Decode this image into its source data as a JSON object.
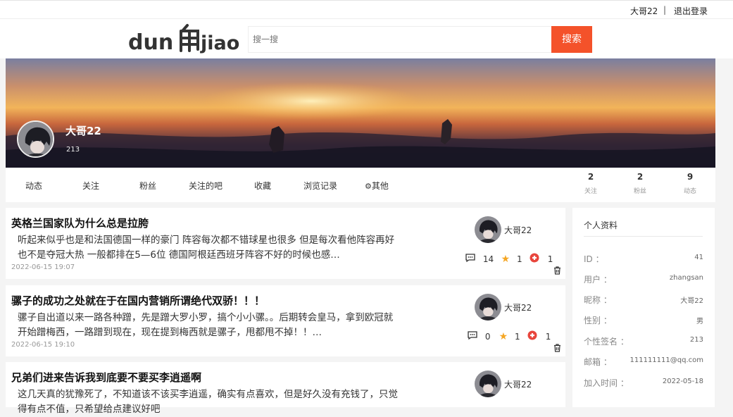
{
  "topbar": {
    "username": "大哥22",
    "separator": "|",
    "logout": "退出登录"
  },
  "header": {
    "logo_text": "dunjiao",
    "search_placeholder": "搜一搜",
    "search_button": "搜索"
  },
  "profile": {
    "name": "大哥22",
    "signature": "213"
  },
  "nav": {
    "tabs": [
      "动态",
      "关注",
      "粉丝",
      "关注的吧",
      "收藏",
      "浏览记录",
      "其他"
    ],
    "stats": [
      {
        "value": "2",
        "label": "关注"
      },
      {
        "value": "2",
        "label": "粉丝"
      },
      {
        "value": "9",
        "label": "动态"
      }
    ]
  },
  "posts": [
    {
      "title": "英格兰国家队为什么总是拉胯",
      "body": "听起来似乎也是和法国德国一样的豪门 阵容每次都不错球星也很多 但是每次看他阵容再好也不是夺冠大热 一般都排在5—6位 德国阿根廷西班牙阵容不好的时候也感…",
      "date": "2022-06-15 19:07",
      "user": "大哥22",
      "comments": "14",
      "stars": "1",
      "likes": "1"
    },
    {
      "title": "骡子的成功之处就在于在国内营销所谓绝代双骄！！！",
      "body": "骡子自出道以来一路各种蹭，先是蹭大罗小罗，搞个小小骡。。后期转会皇马，拿到欧冠就开始蹭梅西，一路蹭到现在，现在提到梅西就是骡子，甩都甩不掉！！…",
      "date": "2022-06-15 19:10",
      "user": "大哥22",
      "comments": "0",
      "stars": "1",
      "likes": "1"
    },
    {
      "title": "兄弟们进来告诉我到底要不要买李逍遥啊",
      "body": "这几天真的犹豫死了，不知道该不该买李逍遥，确实有点喜欢，但是好久没有充钱了，只觉得有点不值，只希望给点建议好吧",
      "date": "",
      "user": "大哥22",
      "comments": "",
      "stars": "",
      "likes": ""
    }
  ],
  "sidebar": {
    "title": "个人资料",
    "rows": [
      {
        "label": "ID ：",
        "value": "41"
      },
      {
        "label": "用户 ：",
        "value": "zhangsan"
      },
      {
        "label": "昵称 ：",
        "value": "大哥22"
      },
      {
        "label": "性别 ：",
        "value": "男"
      },
      {
        "label": "个性签名 ：",
        "value": "213"
      },
      {
        "label": "邮箱 ：",
        "value": "111111111@qq.com"
      },
      {
        "label": "加入时间 ：",
        "value": "2022-05-18"
      }
    ]
  },
  "colors": {
    "accent": "#f4522a",
    "star": "#f5a623",
    "like": "#e8453c"
  }
}
